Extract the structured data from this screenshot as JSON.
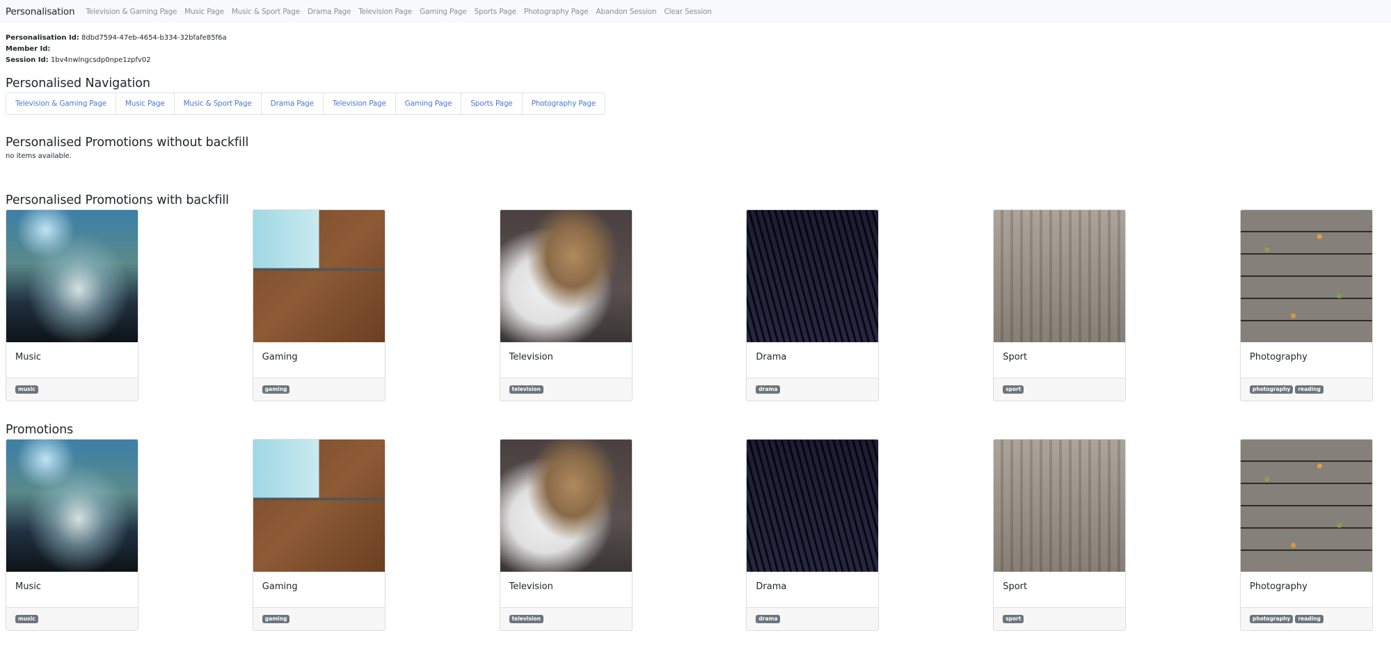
{
  "navbar": {
    "brand": "Personalisation",
    "links": [
      "Television & Gaming Page",
      "Music Page",
      "Music & Sport Page",
      "Drama Page",
      "Television Page",
      "Gaming Page",
      "Sports Page",
      "Photography Page",
      "Abandon Session",
      "Clear Session"
    ]
  },
  "ids": {
    "personalisation_label": "Personalisation Id:",
    "personalisation_value": "8dbd7594-47eb-4654-b334-32bfafe85f6a",
    "member_label": "Member Id:",
    "member_value": "",
    "session_label": "Session Id:",
    "session_value": "1bv4nwlngcsdp0npe1zpfv02"
  },
  "personalised_navigation": {
    "title": "Personalised Navigation",
    "links": [
      "Television & Gaming Page",
      "Music Page",
      "Music & Sport Page",
      "Drama Page",
      "Television Page",
      "Gaming Page",
      "Sports Page",
      "Photography Page"
    ]
  },
  "without_backfill": {
    "title": "Personalised Promotions without backfill",
    "empty_message": "no items available."
  },
  "with_backfill": {
    "title": "Personalised Promotions with backfill",
    "cards": [
      {
        "title": "Music",
        "image": "concert-crowd-photo",
        "tags": [
          "music"
        ]
      },
      {
        "title": "Gaming",
        "image": "laptop-desk-photo",
        "tags": [
          "gaming"
        ]
      },
      {
        "title": "Television",
        "image": "bulldog-photo",
        "tags": [
          "television"
        ]
      },
      {
        "title": "Drama",
        "image": "library-shelves-photo",
        "tags": [
          "drama"
        ]
      },
      {
        "title": "Sport",
        "image": "city-aerial-photo",
        "tags": [
          "sport"
        ]
      },
      {
        "title": "Photography",
        "image": "wooden-deck-leaves-photo",
        "tags": [
          "photography",
          "reading"
        ]
      }
    ]
  },
  "promotions": {
    "title": "Promotions",
    "cards": [
      {
        "title": "Music",
        "image": "concert-crowd-photo",
        "tags": [
          "music"
        ]
      },
      {
        "title": "Gaming",
        "image": "laptop-desk-photo",
        "tags": [
          "gaming"
        ]
      },
      {
        "title": "Television",
        "image": "bulldog-photo",
        "tags": [
          "television"
        ]
      },
      {
        "title": "Drama",
        "image": "library-shelves-photo",
        "tags": [
          "drama"
        ]
      },
      {
        "title": "Sport",
        "image": "city-aerial-photo",
        "tags": [
          "sport"
        ]
      },
      {
        "title": "Photography",
        "image": "wooden-deck-leaves-photo",
        "tags": [
          "photography",
          "reading"
        ]
      }
    ]
  },
  "colors": {
    "navbar_bg": "#f8f9fa",
    "link": "#4a78d6",
    "muted_link": "#8a8f94",
    "badge": "#6c757d"
  }
}
